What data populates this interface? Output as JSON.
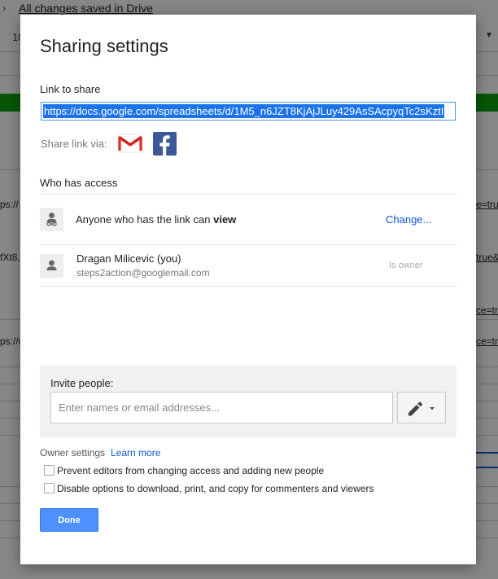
{
  "background": {
    "saved_status": "All changes saved in Drive",
    "zoom_fragment": "10",
    "cells": [
      {
        "text": "ps://",
        "underline": false
      },
      {
        "text": "e=tru",
        "underline": true
      },
      {
        "text": "fXt8,",
        "underline": false
      },
      {
        "text": "true&",
        "underline": true
      },
      {
        "text": "ce=tru",
        "underline": true
      },
      {
        "text": "ps://u",
        "underline": false
      },
      {
        "text": "ce=tru",
        "underline": true
      }
    ]
  },
  "dialog": {
    "title": "Sharing settings",
    "link_label": "Link to share",
    "link_url": "https://docs.google.com/spreadsheets/d/1M5_n6JZT8KjAjJLuy429AsSAcpyqTc2sKztI",
    "share_via_label": "Share link via:",
    "share_icons": [
      "gmail-icon",
      "facebook-icon"
    ],
    "who_has_access_label": "Who has access",
    "access": {
      "anyone_text_prefix": "Anyone who has the link can ",
      "anyone_text_bold": "view",
      "change_label": "Change...",
      "icon": "link-person-icon"
    },
    "owner": {
      "name": "Dragan Milicevic (you)",
      "email": "steps2action@googlemail.com",
      "role": "Is owner",
      "icon": "person-icon"
    },
    "invite": {
      "label": "Invite people:",
      "placeholder": "Enter names or email addresses...",
      "permission_icon": "pencil-icon"
    },
    "owner_settings": {
      "label": "Owner settings",
      "learn_more": "Learn more",
      "options": [
        {
          "label": "Prevent editors from changing access and adding new people",
          "checked": false
        },
        {
          "label": "Disable options to download, print, and copy for commenters and viewers",
          "checked": false
        }
      ]
    },
    "done_label": "Done"
  },
  "colors": {
    "accent": "#4d90fe",
    "link": "#1155cc",
    "facebook": "#3b5998",
    "sheet_green": "#0fa00f"
  }
}
